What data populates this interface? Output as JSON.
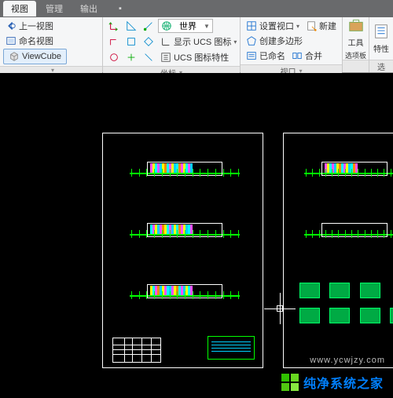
{
  "tabs": {
    "view": "视图",
    "manage": "管理",
    "output": "输出"
  },
  "views_panel": {
    "prev_view": "上一视图",
    "named_view": "命名视图",
    "viewcube": "ViewCube"
  },
  "coord_panel": {
    "title": "坐标",
    "world": "世界",
    "show_ucs": "显示 UCS 图标",
    "ucs_props": "UCS 图标特性"
  },
  "viewport_panel": {
    "title": "视口",
    "set_vp": "设置视口",
    "new_vp": "新建",
    "create_poly": "创建多边形",
    "named": "已命名",
    "merge": "合并"
  },
  "tools": {
    "label": "工具",
    "palette": "选项板"
  },
  "props": {
    "label": "特性"
  },
  "last_panel": "选",
  "watermark": {
    "text": "纯净系统之家",
    "url": "www.ycwjzy.com"
  }
}
